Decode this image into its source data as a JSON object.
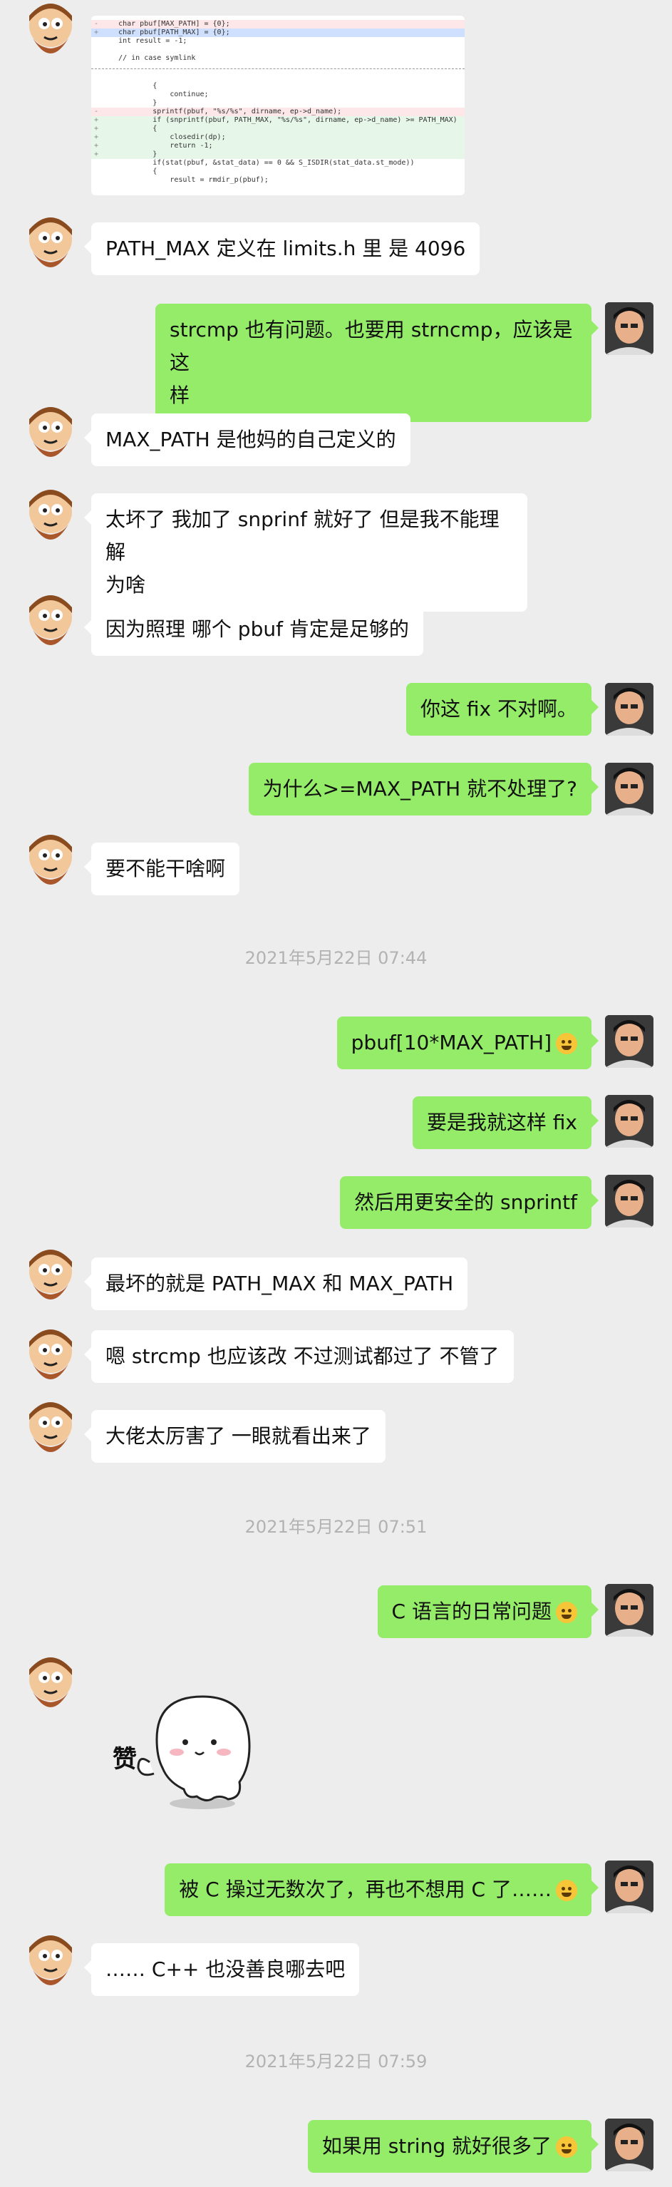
{
  "code_snippet": {
    "lines": [
      {
        "kind": "del",
        "marker": "-",
        "text": "    char pbuf[MAX_PATH] = {0};"
      },
      {
        "kind": "hl",
        "marker": "+",
        "text": "    char pbuf[PATH_MAX] = {0};"
      },
      {
        "kind": "ctx",
        "marker": "",
        "text": "    int result = -1;"
      },
      {
        "kind": "ctx",
        "marker": "",
        "text": ""
      },
      {
        "kind": "ctx",
        "marker": "",
        "text": "    // in case symlink"
      },
      {
        "kind": "sep",
        "marker": "",
        "text": ""
      },
      {
        "kind": "ctx",
        "marker": "",
        "text": ""
      },
      {
        "kind": "ctx",
        "marker": "",
        "text": "            {"
      },
      {
        "kind": "ctx",
        "marker": "",
        "text": "                continue;"
      },
      {
        "kind": "ctx",
        "marker": "",
        "text": "            }"
      },
      {
        "kind": "del",
        "marker": "-",
        "text": "            sprintf(pbuf, \"%s/%s\", dirname, ep->d_name);"
      },
      {
        "kind": "add",
        "marker": "+",
        "text": "            if (snprintf(pbuf, PATH_MAX, \"%s/%s\", dirname, ep->d_name) >= PATH_MAX)"
      },
      {
        "kind": "add",
        "marker": "+",
        "text": "            {"
      },
      {
        "kind": "add",
        "marker": "+",
        "text": "                closedir(dp);"
      },
      {
        "kind": "add",
        "marker": "+",
        "text": "                return -1;"
      },
      {
        "kind": "add",
        "marker": "+",
        "text": "            }"
      },
      {
        "kind": "ctx",
        "marker": "",
        "text": "            if(stat(pbuf, &stat_data) == 0 && S_ISDIR(stat_data.st_mode))"
      },
      {
        "kind": "ctx",
        "marker": "",
        "text": "            {"
      },
      {
        "kind": "ctx",
        "marker": "",
        "text": "                result = rmdir_p(pbuf);"
      }
    ]
  },
  "messages": [
    {
      "id": "m1",
      "text": "PATH_MAX 定义在 limits.h 里 是 4096"
    },
    {
      "id": "m2a",
      "text": "strcmp 也有问题。也要用 strncmp，应该是这"
    },
    {
      "id": "m2b",
      "text": "样"
    },
    {
      "id": "m3",
      "text": "MAX_PATH 是他妈的自己定义的"
    },
    {
      "id": "m4a",
      "text": "太坏了 我加了 snprinf 就好了 但是我不能理解"
    },
    {
      "id": "m4b",
      "text": "为啥"
    },
    {
      "id": "m5",
      "text": "因为照理 哪个 pbuf 肯定是足够的"
    },
    {
      "id": "m6",
      "text": "你这 fix 不对啊。"
    },
    {
      "id": "m7",
      "text": "为什么>=MAX_PATH 就不处理了?"
    },
    {
      "id": "m8",
      "text": "要不能干啥啊"
    },
    {
      "id": "ts1",
      "text": "2021年5月22日 07:44"
    },
    {
      "id": "m9",
      "text": "pbuf[10*MAX_PATH]"
    },
    {
      "id": "m10",
      "text": "要是我就这样 fix"
    },
    {
      "id": "m11",
      "text": "然后用更安全的 snprintf"
    },
    {
      "id": "m12",
      "text": "最坏的就是 PATH_MAX 和 MAX_PATH"
    },
    {
      "id": "m13",
      "text": "嗯 strcmp 也应该改 不过测试都过了 不管了"
    },
    {
      "id": "m14",
      "text": "大佬太厉害了 一眼就看出来了"
    },
    {
      "id": "ts2",
      "text": "2021年5月22日 07:51"
    },
    {
      "id": "m15",
      "text": "C 语言的日常问题"
    },
    {
      "id": "sticker",
      "text": "赞"
    },
    {
      "id": "m16",
      "text": "被 C 操过无数次了，再也不想用 C 了……"
    },
    {
      "id": "m17",
      "text": "…… C++ 也没善良哪去吧"
    },
    {
      "id": "ts3",
      "text": "2021年5月22日 07:59"
    },
    {
      "id": "m18",
      "text": "如果用 string 就好很多了"
    }
  ],
  "colors": {
    "incoming_bubble": "#ffffff",
    "outgoing_bubble": "#95ec69",
    "background": "#ededed",
    "timestamp": "#b2b2b2"
  }
}
